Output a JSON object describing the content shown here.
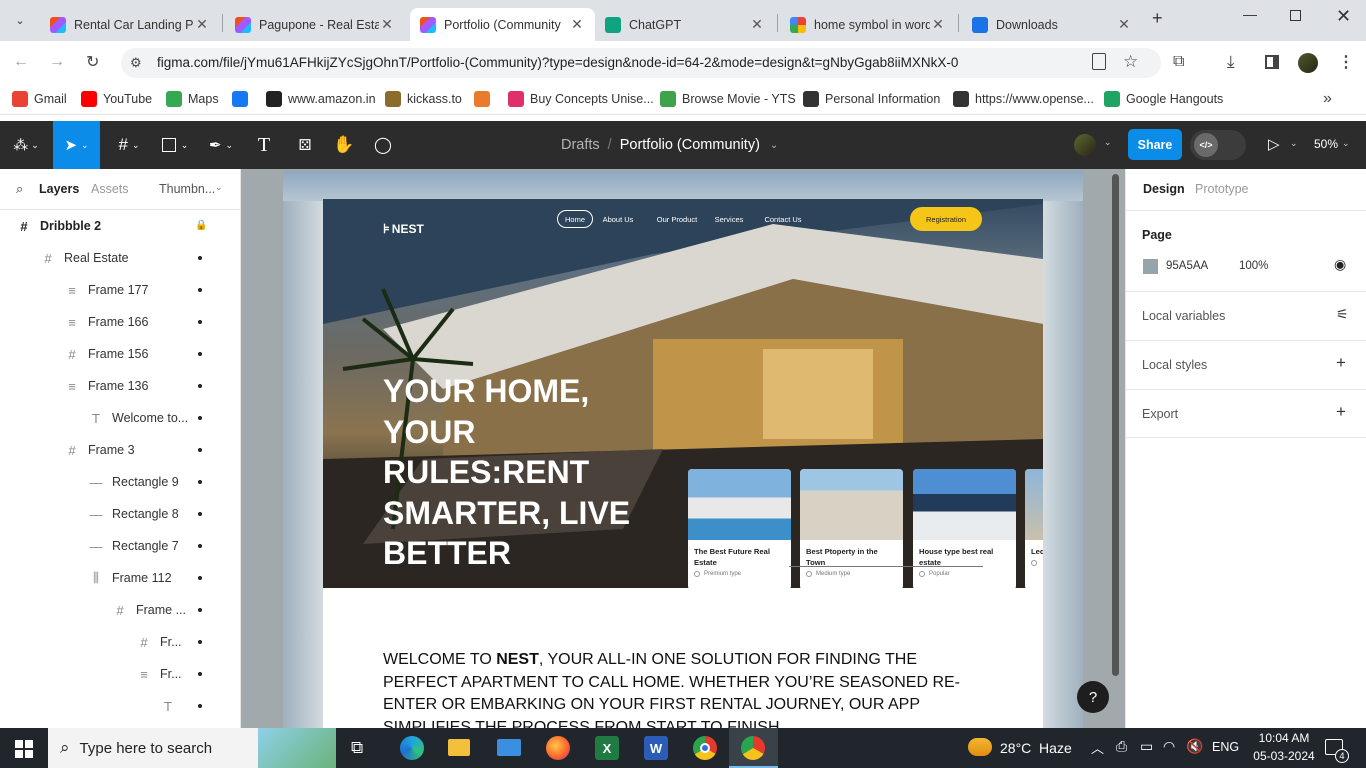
{
  "browser": {
    "tabs": [
      {
        "title": "Rental Car Landing Pa",
        "icon": "figma-icon"
      },
      {
        "title": "Pagupone - Real Esta",
        "icon": "figma-icon"
      },
      {
        "title": "Portfolio (Community",
        "icon": "figma-icon",
        "active": true
      },
      {
        "title": "ChatGPT",
        "icon": "chatgpt-icon"
      },
      {
        "title": "home symbol in word",
        "icon": "google-icon"
      },
      {
        "title": "Downloads",
        "icon": "download-icon"
      }
    ],
    "url": "figma.com/file/jYmu61AFHkijZYcSjgOhnT/Portfolio-(Community)?type=design&node-id=64-2&mode=design&t=gNbyGgab8iiMXNkX-0",
    "bookmarks": [
      "Gmail",
      "YouTube",
      "Maps",
      "",
      "www.amazon.in",
      "kickass.to",
      "",
      "Buy Concepts Unise...",
      "Browse Movie - YTS",
      "Personal Information",
      "https://www.opense...",
      "Google Hangouts"
    ]
  },
  "figma": {
    "breadcrumb_parent": "Drafts",
    "breadcrumb_sep": "/",
    "file_name": "Portfolio (Community)",
    "share_label": "Share",
    "zoom": "50%",
    "left_tabs": [
      "Layers",
      "Assets",
      "Thumbn..."
    ],
    "layers": [
      {
        "name": "Dribbble 2",
        "icon": "#",
        "indent": 0,
        "bold": true
      },
      {
        "name": "Real Estate",
        "icon": "#",
        "indent": 1
      },
      {
        "name": "Frame 177",
        "icon": "≡",
        "indent": 2
      },
      {
        "name": "Frame 166",
        "icon": "≡",
        "indent": 2
      },
      {
        "name": "Frame 156",
        "icon": "#",
        "indent": 2
      },
      {
        "name": "Frame 136",
        "icon": "≡",
        "indent": 2
      },
      {
        "name": "Welcome to...",
        "icon": "T",
        "indent": 3
      },
      {
        "name": "Frame 3",
        "icon": "#",
        "indent": 2
      },
      {
        "name": "Rectangle 9",
        "icon": "—",
        "indent": 3
      },
      {
        "name": "Rectangle 8",
        "icon": "—",
        "indent": 3
      },
      {
        "name": "Rectangle 7",
        "icon": "—",
        "indent": 3
      },
      {
        "name": "Frame 112",
        "icon": "⫼",
        "indent": 3
      },
      {
        "name": "Frame ...",
        "icon": "#",
        "indent": 4
      },
      {
        "name": "Fr...",
        "icon": "#",
        "indent": 5
      },
      {
        "name": "Fr...",
        "icon": "≡",
        "indent": 5
      },
      {
        "name": "",
        "icon": "T",
        "indent": 6
      }
    ],
    "right_tabs": [
      "Design",
      "Prototype"
    ],
    "page_label": "Page",
    "page_color": "95A5AA",
    "page_opacity": "100%",
    "sections": [
      "Local variables",
      "Local styles",
      "Export"
    ]
  },
  "design": {
    "logo": "NEST",
    "nav": [
      "Home",
      "About Us",
      "Our Product",
      "Services",
      "Contact Us"
    ],
    "cta": "Registration",
    "hero_lines": [
      "YOUR HOME,",
      "YOUR",
      "RULES:RENT",
      "SMARTER, LIVE",
      "BETTER"
    ],
    "cards": [
      {
        "title": "The Best Future Real Estate",
        "tag": "Premium type"
      },
      {
        "title": "Best Ptoperty in the Town",
        "tag": "Medium type"
      },
      {
        "title": "House type best real estate",
        "tag": "Popular"
      },
      {
        "title": "Lec Bes",
        "tag": ""
      }
    ],
    "welcome_pre": "WELCOME TO ",
    "welcome_brand": "NEST",
    "welcome_post": ", YOUR  ALL-IN ONE SOLUTION FOR FINDING THE PERFECT APARTMENT TO CALL HOME. WHETHER YOU’RE SEASONED RE-ENTER OR EMBARKING ON YOUR FIRST RENTAL JOURNEY, OUR APP SIMPLIFIES THE PROCESS FROM START TO FINISH"
  },
  "taskbar": {
    "search_placeholder": "Type here to search",
    "weather": "28°C  Haze",
    "lang": "ENG",
    "time": "10:04 AM",
    "date": "05-03-2024",
    "notif_count": "4"
  }
}
